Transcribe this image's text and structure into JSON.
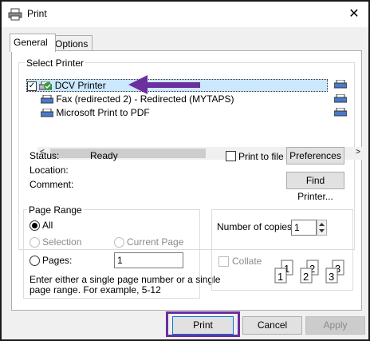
{
  "window": {
    "title": "Print"
  },
  "tabs": [
    {
      "label": "General"
    },
    {
      "label": "Options"
    }
  ],
  "select_printer": {
    "group_label": "Select Printer",
    "printers": [
      {
        "name": "DCV Printer"
      },
      {
        "name": "Fax (redirected 2) - Redirected (MYTAPS)"
      },
      {
        "name": "Microsoft Print to PDF"
      }
    ],
    "status_label": "Status:",
    "status_value": "Ready",
    "location_label": "Location:",
    "comment_label": "Comment:",
    "print_to_file_label": "Print to file",
    "preferences_label": "Preferences",
    "find_printer_label": "Find Printer..."
  },
  "page_range": {
    "group_label": "Page Range",
    "all_label": "All",
    "selection_label": "Selection",
    "current_page_label": "Current Page",
    "pages_label": "Pages:",
    "pages_value": "1",
    "help_text_line1": "Enter either a single page number or a single",
    "help_text_line2": "page range.  For example, 5-12"
  },
  "copies": {
    "number_label": "Number of copies:",
    "number_value": "1",
    "collate_label": "Collate"
  },
  "footer": {
    "print_label": "Print",
    "cancel_label": "Cancel",
    "apply_label": "Apply"
  },
  "colors": {
    "annotation": "#6b2f9e",
    "selection": "#cce8ff",
    "status_ok": "#2e9e3a"
  }
}
